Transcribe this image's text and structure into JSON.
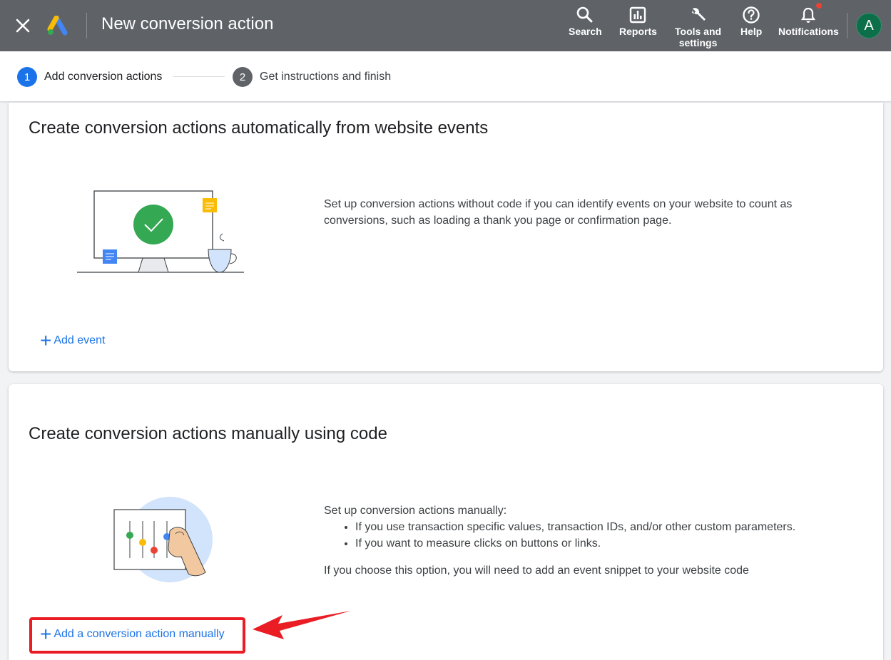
{
  "header": {
    "title": "New conversion action",
    "nav": {
      "search": "Search",
      "reports": "Reports",
      "tools_line1": "Tools and",
      "tools_line2": "settings",
      "help": "Help",
      "notifications": "Notifications"
    },
    "avatar_initial": "A",
    "colors": {
      "bar": "#5f6368",
      "avatar": "#0d6e4a"
    }
  },
  "stepper": {
    "steps": [
      {
        "number": "1",
        "label": "Add conversion actions",
        "state": "active"
      },
      {
        "number": "2",
        "label": "Get instructions and finish",
        "state": "inactive"
      }
    ]
  },
  "auto_section": {
    "title": "Create conversion actions automatically from website events",
    "description": "Set up conversion actions without code if you can identify events on your website to count as conversions, such as loading a thank you page or confirmation page.",
    "button": "Add event"
  },
  "manual_section": {
    "title": "Create conversion actions manually using code",
    "intro": "Set up conversion actions manually:",
    "bullets": [
      "If you use transaction specific values, transaction IDs, and/or other custom parameters.",
      "If you want to measure clicks on buttons or links."
    ],
    "note": "If you choose this option, you will need to add an event snippet to your website code",
    "button": "Add a conversion action manually"
  },
  "annotation": {
    "color": "#ea1c24"
  }
}
